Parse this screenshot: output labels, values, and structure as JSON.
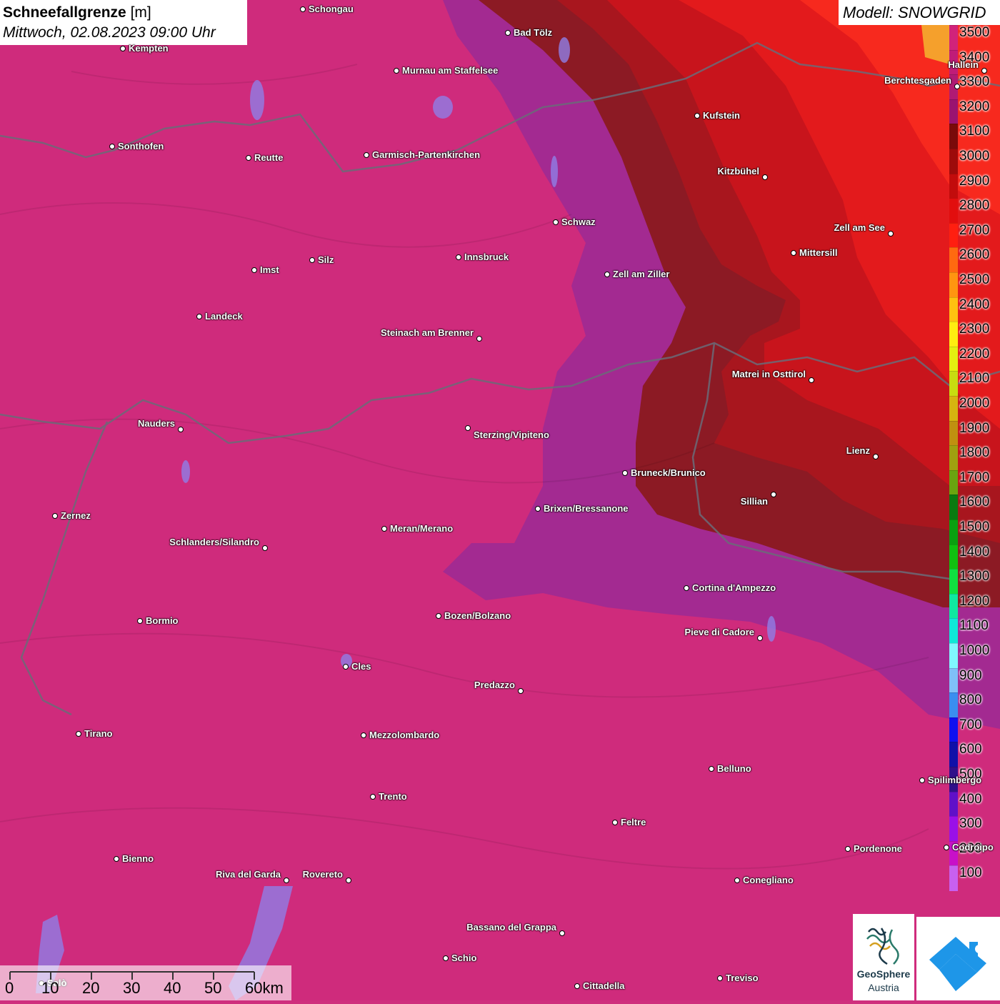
{
  "title": {
    "main": "Schneefallgrenze",
    "unit": "[m]",
    "datetime": "Mittwoch, 02.08.2023 09:00 Uhr"
  },
  "model": {
    "label": "Modell: SNOWGRID"
  },
  "legend": {
    "levels": [
      {
        "label": "3500",
        "color": "#d1237a"
      },
      {
        "label": "3400",
        "color": "#c01c78"
      },
      {
        "label": "3300",
        "color": "#b01a74"
      },
      {
        "label": "3200",
        "color": "#9a1370"
      },
      {
        "label": "3100",
        "color": "#7a0a0a"
      },
      {
        "label": "3000",
        "color": "#9d0b0b"
      },
      {
        "label": "2900",
        "color": "#c20c0c"
      },
      {
        "label": "2800",
        "color": "#e20e0e"
      },
      {
        "label": "2700",
        "color": "#ff1f10"
      },
      {
        "label": "2600",
        "color": "#ff6a10"
      },
      {
        "label": "2500",
        "color": "#ff9510"
      },
      {
        "label": "2400",
        "color": "#ffc010"
      },
      {
        "label": "2300",
        "color": "#ffee10"
      },
      {
        "label": "2200",
        "color": "#e4f010"
      },
      {
        "label": "2100",
        "color": "#c8dc10"
      },
      {
        "label": "2000",
        "color": "#d6b410"
      },
      {
        "label": "1900",
        "color": "#c09010"
      },
      {
        "label": "1800",
        "color": "#a0a010"
      },
      {
        "label": "1700",
        "color": "#6aa410"
      },
      {
        "label": "1600",
        "color": "#0a7a10"
      },
      {
        "label": "1500",
        "color": "#0aa010"
      },
      {
        "label": "1400",
        "color": "#10c010"
      },
      {
        "label": "1300",
        "color": "#10e040"
      },
      {
        "label": "1200",
        "color": "#10e8a0"
      },
      {
        "label": "1100",
        "color": "#10e8d8"
      },
      {
        "label": "1000",
        "color": "#80f8ff"
      },
      {
        "label": "900",
        "color": "#80c0f8"
      },
      {
        "label": "800",
        "color": "#3a8ef0"
      },
      {
        "label": "700",
        "color": "#1010f0"
      },
      {
        "label": "600",
        "color": "#1010a8"
      },
      {
        "label": "500",
        "color": "#30108a"
      },
      {
        "label": "400",
        "color": "#6010c8"
      },
      {
        "label": "300",
        "color": "#9a10e8"
      },
      {
        "label": "200",
        "color": "#c810c8"
      },
      {
        "label": "100",
        "color": "#c860f0"
      }
    ]
  },
  "cities": [
    {
      "name": "Schongau"
    },
    {
      "name": "Bad Tölz"
    },
    {
      "name": "Kempten"
    },
    {
      "name": "Murnau am Staffelsee"
    },
    {
      "name": "Hallein"
    },
    {
      "name": "Berchtesgaden"
    },
    {
      "name": "Kufstein"
    },
    {
      "name": "Sonthofen"
    },
    {
      "name": "Reutte"
    },
    {
      "name": "Garmisch-Partenkirchen"
    },
    {
      "name": "Kitzbühel"
    },
    {
      "name": "Schwaz"
    },
    {
      "name": "Zell am See"
    },
    {
      "name": "Mittersill"
    },
    {
      "name": "Innsbruck"
    },
    {
      "name": "Silz"
    },
    {
      "name": "Imst"
    },
    {
      "name": "Zell am Ziller"
    },
    {
      "name": "Landeck"
    },
    {
      "name": "Steinach am Brenner"
    },
    {
      "name": "Matrei in Osttirol"
    },
    {
      "name": "Nauders"
    },
    {
      "name": "Sterzing/Vipiteno"
    },
    {
      "name": "Lienz"
    },
    {
      "name": "Bruneck/Brunico"
    },
    {
      "name": "Sillian"
    },
    {
      "name": "Zernez"
    },
    {
      "name": "Brixen/Bressanone"
    },
    {
      "name": "Meran/Merano"
    },
    {
      "name": "Schlanders/Silandro"
    },
    {
      "name": "Cortina d'Ampezzo"
    },
    {
      "name": "Bozen/Bolzano"
    },
    {
      "name": "Bormio"
    },
    {
      "name": "Pieve di Cadore"
    },
    {
      "name": "Cles"
    },
    {
      "name": "Predazzo"
    },
    {
      "name": "Tirano"
    },
    {
      "name": "Mezzolombardo"
    },
    {
      "name": "Belluno"
    },
    {
      "name": "Spilimbergo"
    },
    {
      "name": "Trento"
    },
    {
      "name": "Feltre"
    },
    {
      "name": "Pordenone"
    },
    {
      "name": "Codroipo"
    },
    {
      "name": "Bienno"
    },
    {
      "name": "Riva del Garda"
    },
    {
      "name": "Rovereto"
    },
    {
      "name": "Conegliano"
    },
    {
      "name": "Bassano del Grappa"
    },
    {
      "name": "Schio"
    },
    {
      "name": "Salò"
    },
    {
      "name": "Treviso"
    },
    {
      "name": "Cittadella"
    }
  ],
  "scale": {
    "ticks": [
      "0",
      "10",
      "20",
      "30",
      "40",
      "50",
      "60km"
    ]
  },
  "logos": {
    "geosphere_line1": "GeoSphere",
    "geosphere_line2": "Austria"
  }
}
